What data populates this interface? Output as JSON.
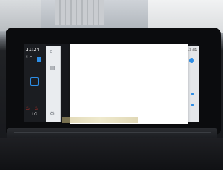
{
  "clock": "11:24",
  "left_status": "☼ ↗",
  "heating_label": "LO",
  "heat_icons": "♨ ♨",
  "map_time": "13:31",
  "strip_icons": [
    "⌕",
    "▤",
    "⚙"
  ],
  "colors": {
    "accent": "#2d8ee6",
    "heat": "#e0342c"
  }
}
